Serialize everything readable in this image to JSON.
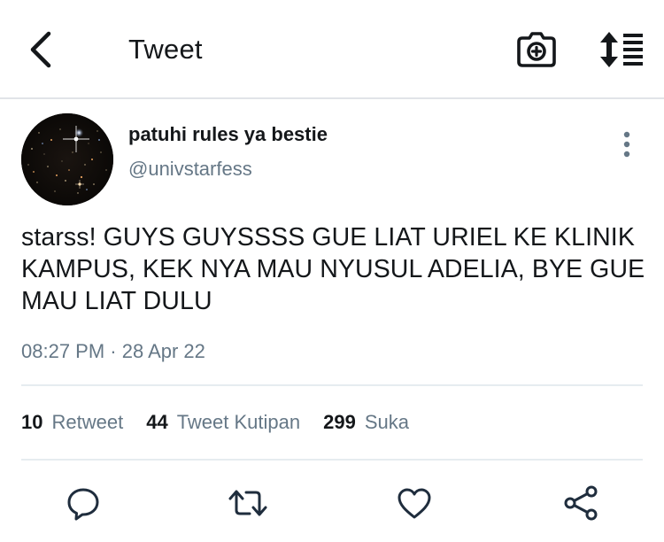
{
  "header": {
    "title": "Tweet",
    "icons": {
      "back": "chevron-left-icon",
      "camera": "camera-add-icon",
      "sort": "sort-list-icon"
    }
  },
  "tweet": {
    "display_name": "patuhi rules ya bestie",
    "handle": "@univstarfess",
    "text": "starss! GUYS GUYSSSS GUE LIAT URIEL KE KLINIK KAMPUS, KEK NYA MAU NYUSUL ADELIA, BYE GUE MAU LIAT DULU",
    "timestamp": "08:27 PM · 28 Apr 22"
  },
  "stats": {
    "retweets": {
      "count": "10",
      "label": "Retweet"
    },
    "quotes": {
      "count": "44",
      "label": "Tweet Kutipan"
    },
    "likes": {
      "count": "299",
      "label": "Suka"
    }
  },
  "actions": [
    "reply-icon",
    "retweet-icon",
    "like-icon",
    "share-icon"
  ],
  "colors": {
    "text": "#14171a",
    "secondary": "#657786",
    "icon": "#1f2d3d",
    "divider": "#e6ecf0"
  }
}
